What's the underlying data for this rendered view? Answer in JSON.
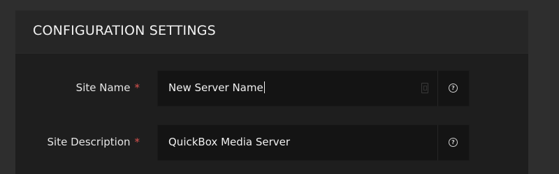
{
  "panel": {
    "title": "CONFIGURATION SETTINGS"
  },
  "fields": [
    {
      "label": "Site Name",
      "required_mark": "*",
      "value": "New Server Name",
      "help_icon": "question-circle-icon"
    },
    {
      "label": "Site Description",
      "required_mark": "*",
      "value": "QuickBox Media Server",
      "help_icon": "question-circle-icon"
    }
  ],
  "help_glyph": "?",
  "colors": {
    "page_background": "#2e2e2e",
    "panel_background": "#1e1e1e",
    "header_background": "#262626",
    "input_background": "#141414",
    "required": "#d9534f",
    "text": "#f0f0f0"
  }
}
